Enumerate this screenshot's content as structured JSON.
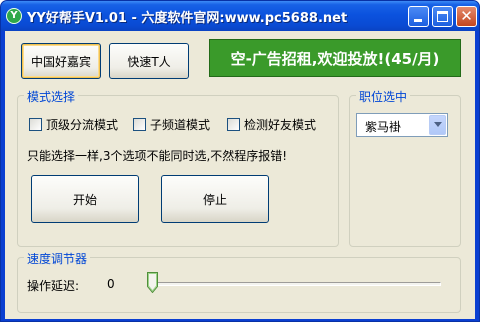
{
  "window": {
    "title": "YY好帮手V1.01 - 六度软件官网:www.pc5688.net",
    "icon_glyph": "Y"
  },
  "toolbar": {
    "china_good_guest_label": "中国好嘉宾",
    "quick_kick_label": "快速T人"
  },
  "ad_banner": {
    "text": "空-广告招租,欢迎投放!(45/月)",
    "color": "#3a9a2a"
  },
  "mode_group": {
    "label": "模式选择",
    "options": [
      {
        "label": "顶级分流模式",
        "checked": false
      },
      {
        "label": "子频道模式",
        "checked": false
      },
      {
        "label": "检测好友模式",
        "checked": false
      }
    ],
    "notice": "只能选择一样,3个选项不能同时选,不然程序报错!"
  },
  "actions": {
    "start_label": "开始",
    "stop_label": "停止"
  },
  "position_group": {
    "label": "职位选中",
    "selected": "紫马褂"
  },
  "speed_group": {
    "label": "速度调节器",
    "delay_label": "操作延迟:",
    "delay_value": "0",
    "slider_fraction": 0.0
  },
  "colors": {
    "group_label": "#0046d5",
    "title_bar": "#0a4bd4",
    "client_bg": "#ece9d8"
  },
  "icons": [
    "app-icon",
    "minimize-icon",
    "maximize-icon",
    "close-icon",
    "chevron-down-icon"
  ]
}
